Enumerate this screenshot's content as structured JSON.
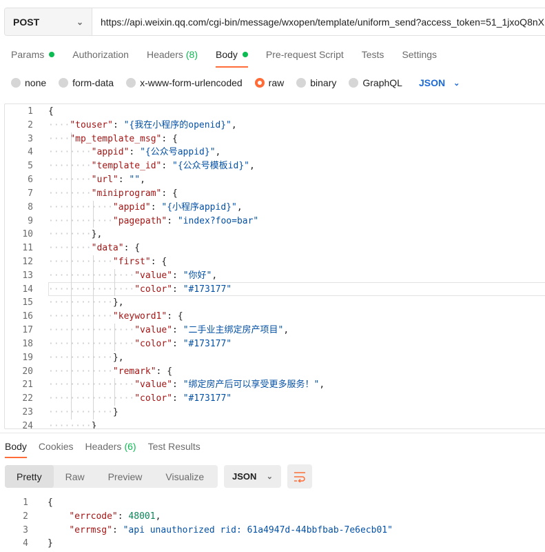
{
  "request": {
    "method": "POST",
    "url": "https://api.weixin.qq.com/cgi-bin/message/wxopen/template/uniform_send?access_token=51_1jxoQ8nX"
  },
  "request_tabs": [
    {
      "label": "Params",
      "indicator": "dot"
    },
    {
      "label": "Authorization"
    },
    {
      "label": "Headers",
      "count": "(8)"
    },
    {
      "label": "Body",
      "indicator": "dot",
      "active": true
    },
    {
      "label": "Pre-request Script"
    },
    {
      "label": "Tests"
    },
    {
      "label": "Settings"
    }
  ],
  "body_types": [
    "none",
    "form-data",
    "x-www-form-urlencoded",
    "raw",
    "binary",
    "GraphQL"
  ],
  "body_type_selected": "raw",
  "body_format": "JSON",
  "request_body_lines": [
    {
      "n": "1",
      "indent": 0,
      "tokens": [
        [
          "p",
          "{"
        ]
      ]
    },
    {
      "n": "2",
      "indent": 1,
      "tokens": [
        [
          "k",
          "\"touser\""
        ],
        [
          "p",
          ": "
        ],
        [
          "s",
          "\"{我在小程序的openid}\""
        ],
        [
          "p",
          ","
        ]
      ]
    },
    {
      "n": "3",
      "indent": 1,
      "tokens": [
        [
          "k",
          "\"mp_template_msg\""
        ],
        [
          "p",
          ": {"
        ]
      ]
    },
    {
      "n": "4",
      "indent": 2,
      "tokens": [
        [
          "k",
          "\"appid\""
        ],
        [
          "p",
          ": "
        ],
        [
          "s",
          "\"{公众号appid}\""
        ],
        [
          "p",
          ","
        ]
      ]
    },
    {
      "n": "5",
      "indent": 2,
      "tokens": [
        [
          "k",
          "\"template_id\""
        ],
        [
          "p",
          ": "
        ],
        [
          "s",
          "\"{公众号模板id}\""
        ],
        [
          "p",
          ","
        ]
      ]
    },
    {
      "n": "6",
      "indent": 2,
      "tokens": [
        [
          "k",
          "\"url\""
        ],
        [
          "p",
          ": "
        ],
        [
          "s",
          "\"\""
        ],
        [
          "p",
          ","
        ]
      ]
    },
    {
      "n": "7",
      "indent": 2,
      "tokens": [
        [
          "k",
          "\"miniprogram\""
        ],
        [
          "p",
          ": {"
        ]
      ]
    },
    {
      "n": "8",
      "indent": 3,
      "tokens": [
        [
          "k",
          "\"appid\""
        ],
        [
          "p",
          ": "
        ],
        [
          "s",
          "\"{小程序appid}\""
        ],
        [
          "p",
          ","
        ]
      ]
    },
    {
      "n": "9",
      "indent": 3,
      "tokens": [
        [
          "k",
          "\"pagepath\""
        ],
        [
          "p",
          ": "
        ],
        [
          "s",
          "\"index?foo=bar\""
        ]
      ]
    },
    {
      "n": "10",
      "indent": 2,
      "tokens": [
        [
          "p",
          "},"
        ]
      ]
    },
    {
      "n": "11",
      "indent": 2,
      "tokens": [
        [
          "k",
          "\"data\""
        ],
        [
          "p",
          ": {"
        ]
      ]
    },
    {
      "n": "12",
      "indent": 3,
      "tokens": [
        [
          "k",
          "\"first\""
        ],
        [
          "p",
          ": {"
        ]
      ]
    },
    {
      "n": "13",
      "indent": 4,
      "tokens": [
        [
          "k",
          "\"value\""
        ],
        [
          "p",
          ": "
        ],
        [
          "s",
          "\"你好\""
        ],
        [
          "p",
          ","
        ]
      ]
    },
    {
      "n": "14",
      "indent": 4,
      "tokens": [
        [
          "k",
          "\"color\""
        ],
        [
          "p",
          ": "
        ],
        [
          "s",
          "\"#173177\""
        ]
      ]
    },
    {
      "n": "15",
      "indent": 3,
      "tokens": [
        [
          "p",
          "},"
        ]
      ]
    },
    {
      "n": "16",
      "indent": 3,
      "tokens": [
        [
          "k",
          "\"keyword1\""
        ],
        [
          "p",
          ": {"
        ]
      ]
    },
    {
      "n": "17",
      "indent": 4,
      "tokens": [
        [
          "k",
          "\"value\""
        ],
        [
          "p",
          ": "
        ],
        [
          "s",
          "\"二手业主绑定房产项目\""
        ],
        [
          "p",
          ","
        ]
      ]
    },
    {
      "n": "18",
      "indent": 4,
      "tokens": [
        [
          "k",
          "\"color\""
        ],
        [
          "p",
          ": "
        ],
        [
          "s",
          "\"#173177\""
        ]
      ]
    },
    {
      "n": "19",
      "indent": 3,
      "tokens": [
        [
          "p",
          "},"
        ]
      ]
    },
    {
      "n": "20",
      "indent": 3,
      "tokens": [
        [
          "k",
          "\"remark\""
        ],
        [
          "p",
          ": {"
        ]
      ]
    },
    {
      "n": "21",
      "indent": 4,
      "tokens": [
        [
          "k",
          "\"value\""
        ],
        [
          "p",
          ": "
        ],
        [
          "s",
          "\"绑定房产后可以享受更多服务！\""
        ],
        [
          "p",
          ","
        ]
      ]
    },
    {
      "n": "22",
      "indent": 4,
      "tokens": [
        [
          "k",
          "\"color\""
        ],
        [
          "p",
          ": "
        ],
        [
          "s",
          "\"#173177\""
        ]
      ]
    },
    {
      "n": "23",
      "indent": 3,
      "tokens": [
        [
          "p",
          "}"
        ]
      ]
    },
    {
      "n": "24",
      "indent": 2,
      "tokens": [
        [
          "p",
          "}"
        ]
      ]
    }
  ],
  "response_tabs": [
    {
      "label": "Body",
      "active": true
    },
    {
      "label": "Cookies"
    },
    {
      "label": "Headers",
      "count": "(6)"
    },
    {
      "label": "Test Results"
    }
  ],
  "response_views": [
    "Pretty",
    "Raw",
    "Preview",
    "Visualize"
  ],
  "response_view_selected": "Pretty",
  "response_format": "JSON",
  "response_body_lines": [
    {
      "n": "1",
      "tokens": [
        [
          "p",
          "{"
        ]
      ]
    },
    {
      "n": "2",
      "tokens": [
        [
          "p",
          "    "
        ],
        [
          "k",
          "\"errcode\""
        ],
        [
          "p",
          ": "
        ],
        [
          "n",
          "48001"
        ],
        [
          "p",
          ","
        ]
      ]
    },
    {
      "n": "3",
      "tokens": [
        [
          "p",
          "    "
        ],
        [
          "k",
          "\"errmsg\""
        ],
        [
          "p",
          ": "
        ],
        [
          "s",
          "\"api unauthorized rid: 61a4947d-44bbfbab-7e6ecb01\""
        ]
      ]
    },
    {
      "n": "4",
      "tokens": [
        [
          "p",
          "}"
        ]
      ]
    }
  ],
  "colors": {
    "accent": "#ff6c37",
    "indicator_green": "#0cbb52",
    "json_key": "#a31515",
    "json_string": "#0451a5",
    "json_number": "#098658",
    "link_blue": "#1d6ad7"
  }
}
